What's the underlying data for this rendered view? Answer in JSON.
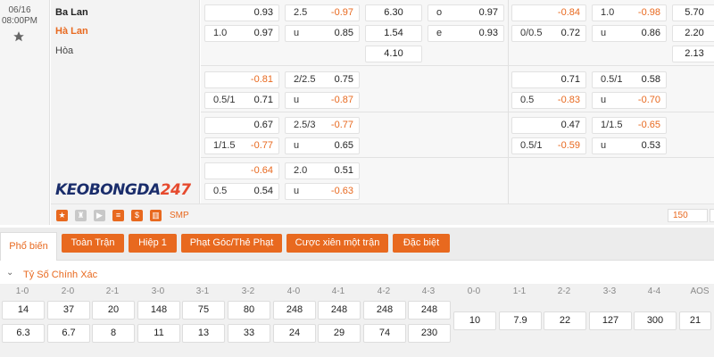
{
  "match": {
    "date": "06/16",
    "time": "08:00PM",
    "home": "Ba Lan",
    "away": "Hà Lan",
    "draw": "Hòa"
  },
  "logo": {
    "text1": "KEOBONGDA",
    "text2": "247"
  },
  "rows": [
    {
      "cells": [
        {
          "lbl": "",
          "val": "0.93",
          "neg": false
        },
        {
          "lbl": "2.5",
          "val": "-0.97",
          "neg": true
        },
        {
          "center": "6.30"
        },
        {
          "lbl": "o",
          "val": "0.97",
          "neg": false
        },
        {
          "lbl": "",
          "val": "-0.84",
          "neg": true
        },
        {
          "lbl": "1.0",
          "val": "-0.98",
          "neg": true
        },
        {
          "center": "5.70"
        }
      ],
      "cells2": [
        {
          "lbl": "1.0",
          "val": "0.97",
          "neg": false
        },
        {
          "lbl": "u",
          "val": "0.85",
          "neg": false
        },
        {
          "center": "1.54"
        },
        {
          "lbl": "e",
          "val": "0.93",
          "neg": false
        },
        {
          "lbl": "0/0.5",
          "val": "0.72",
          "neg": false
        },
        {
          "lbl": "u",
          "val": "0.86",
          "neg": false
        },
        {
          "center": "2.20"
        }
      ],
      "third": [
        "4.10",
        "2.13"
      ]
    },
    {
      "cells": [
        {
          "lbl": "",
          "val": "-0.81",
          "neg": true
        },
        {
          "lbl": "2/2.5",
          "val": "0.75",
          "neg": false
        },
        {
          "lbl": "",
          "val": "0.71",
          "neg": false
        },
        {
          "lbl": "0.5/1",
          "val": "0.58",
          "neg": false
        }
      ],
      "cells2": [
        {
          "lbl": "0.5/1",
          "val": "0.71",
          "neg": false
        },
        {
          "lbl": "u",
          "val": "-0.87",
          "neg": true
        },
        {
          "lbl": "0.5",
          "val": "-0.83",
          "neg": true
        },
        {
          "lbl": "u",
          "val": "-0.70",
          "neg": true
        }
      ]
    },
    {
      "cells": [
        {
          "lbl": "",
          "val": "0.67",
          "neg": false
        },
        {
          "lbl": "2.5/3",
          "val": "-0.77",
          "neg": true
        },
        {
          "lbl": "",
          "val": "0.47",
          "neg": false
        },
        {
          "lbl": "1/1.5",
          "val": "-0.65",
          "neg": true
        }
      ],
      "cells2": [
        {
          "lbl": "1/1.5",
          "val": "-0.77",
          "neg": true
        },
        {
          "lbl": "u",
          "val": "0.65",
          "neg": false
        },
        {
          "lbl": "0.5/1",
          "val": "-0.59",
          "neg": true
        },
        {
          "lbl": "u",
          "val": "0.53",
          "neg": false
        }
      ]
    },
    {
      "cells": [
        {
          "lbl": "",
          "val": "-0.64",
          "neg": true
        },
        {
          "lbl": "2.0",
          "val": "0.51",
          "neg": false
        }
      ],
      "cells2": [
        {
          "lbl": "0.5",
          "val": "0.54",
          "neg": false
        },
        {
          "lbl": "u",
          "val": "-0.63",
          "neg": true
        }
      ]
    }
  ],
  "toolbar": {
    "smp": "SMP",
    "page": "150",
    "icons": [
      "star-icon",
      "shirt-icon",
      "play-icon",
      "list-icon",
      "dollar-icon",
      "chart-icon"
    ]
  },
  "tabs": {
    "active": "Phổ biến",
    "items": [
      "Toàn Trận",
      "Hiệp 1",
      "Phạt Góc/Thẻ Phạt",
      "Cược xiên một trận",
      "Đặc biệt"
    ]
  },
  "section": {
    "title": "Tỷ Số Chính Xác"
  },
  "correct_score": {
    "headers": [
      "1-0",
      "2-0",
      "2-1",
      "3-0",
      "3-1",
      "3-2",
      "4-0",
      "4-1",
      "4-2",
      "4-3",
      "0-0",
      "1-1",
      "2-2",
      "3-3",
      "4-4",
      "AOS"
    ],
    "home": [
      "14",
      "37",
      "20",
      "148",
      "75",
      "80",
      "248",
      "248",
      "248",
      "248"
    ],
    "away": [
      "6.3",
      "6.7",
      "8",
      "11",
      "13",
      "33",
      "24",
      "29",
      "74",
      "230"
    ],
    "draws": [
      "10",
      "7.9",
      "22",
      "127",
      "300",
      "21"
    ]
  },
  "colors": {
    "accent": "#e8691f",
    "logo_blue": "#1a2d6b"
  }
}
